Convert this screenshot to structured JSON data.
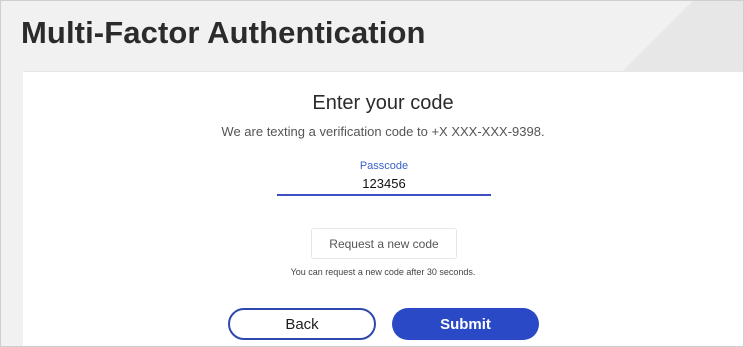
{
  "page": {
    "title": "Multi-Factor Authentication"
  },
  "card": {
    "heading": "Enter your code",
    "subtitle": "We are texting a verification code to +X XXX-XXX-9398.",
    "passcode": {
      "label": "Passcode",
      "value": "123456",
      "placeholder": ""
    },
    "request_button_label": "Request a new code",
    "request_note": "You can request a new code after 30 seconds.",
    "back_label": "Back",
    "submit_label": "Submit"
  },
  "colors": {
    "accent": "#2a49c6",
    "title": "#2b2b2b",
    "label": "#3d61c8"
  }
}
